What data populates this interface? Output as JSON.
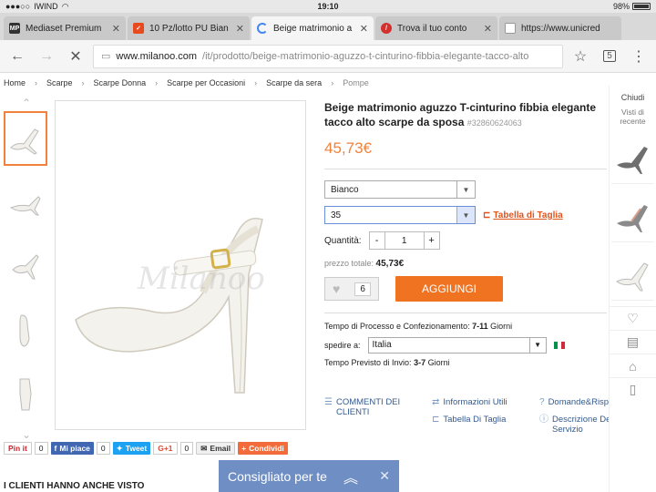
{
  "status": {
    "carrier": "IWIND",
    "time": "19:10",
    "battery": "98%"
  },
  "tabs": [
    {
      "title": "Mediaset Premium",
      "fav_text": "MP",
      "fav_color": "#333333"
    },
    {
      "title": "10 Pz/lotto PU Bian",
      "fav_text": "✓",
      "fav_color": "#e8491d"
    },
    {
      "title": "Beige matrimonio a",
      "fav_text": "",
      "fav_color": "#4285f4"
    },
    {
      "title": "Trova il tuo conto",
      "fav_text": "",
      "fav_color": "#d32f2f"
    },
    {
      "title": "https://www.unicred",
      "fav_text": "",
      "fav_color": "#9e9e9e"
    }
  ],
  "toolbar": {
    "url_host": "www.milanoo.com",
    "url_path": "/it/prodotto/beige-matrimonio-aguzzo-t-cinturino-fibbia-elegante-tacco-alto",
    "tab_count": "5"
  },
  "breadcrumb": [
    "Home",
    "Scarpe",
    "Scarpe Donna",
    "Scarpe per Occasioni",
    "Scarpe da sera",
    "Pompe"
  ],
  "product": {
    "title_line1": "Beige matrimonio aguzzo T-cinturino fibbia elegante",
    "title_line2": "tacco alto scarpe da sposa",
    "code": "#32860624063",
    "price": "45,73€",
    "color_value": "Bianco",
    "size_value": "35",
    "size_chart_label": "Tabella di Taglia",
    "quantity_label": "Quantità:",
    "quantity_value": "1",
    "total_label": "prezzo totale:",
    "total_value": "45,73€",
    "likes": "6",
    "add_label": "AGGIUNGI",
    "processing_label": "Tempo di Processo e Confezionamento:",
    "processing_value": "7-11",
    "processing_unit": "Giorni",
    "ship_label": "spedire a:",
    "ship_country": "Italia",
    "delivery_label": "Tempo Previsto di Invio:",
    "delivery_value": "3-7",
    "delivery_unit": "Giorni",
    "watermark": "Milanoo"
  },
  "links": [
    {
      "icon": "comment-icon",
      "label": "COMMENTI DEI CLIENTI"
    },
    {
      "icon": "refresh-icon",
      "label": "Informazioni Utili"
    },
    {
      "icon": "question-icon",
      "label": "Domande&Risposte"
    },
    {
      "icon": "size-icon",
      "label": "Tabella Di Taglia"
    },
    {
      "icon": "info-icon",
      "label": "Descrizione Del Servizio"
    }
  ],
  "share": {
    "pinit": "Pin it",
    "pin_count": "0",
    "fb": "Mi piace",
    "fb_count": "0",
    "tweet": "Tweet",
    "gplus": "G+1",
    "gplus_count": "0",
    "email": "Email",
    "condividi": "Condividi"
  },
  "also_seen": "I CLIENTI HANNO ANCHE VISTO",
  "consigliato": "Consigliato per te",
  "sidebar": {
    "close": "Chiudi",
    "recent": "Visti di recente"
  }
}
